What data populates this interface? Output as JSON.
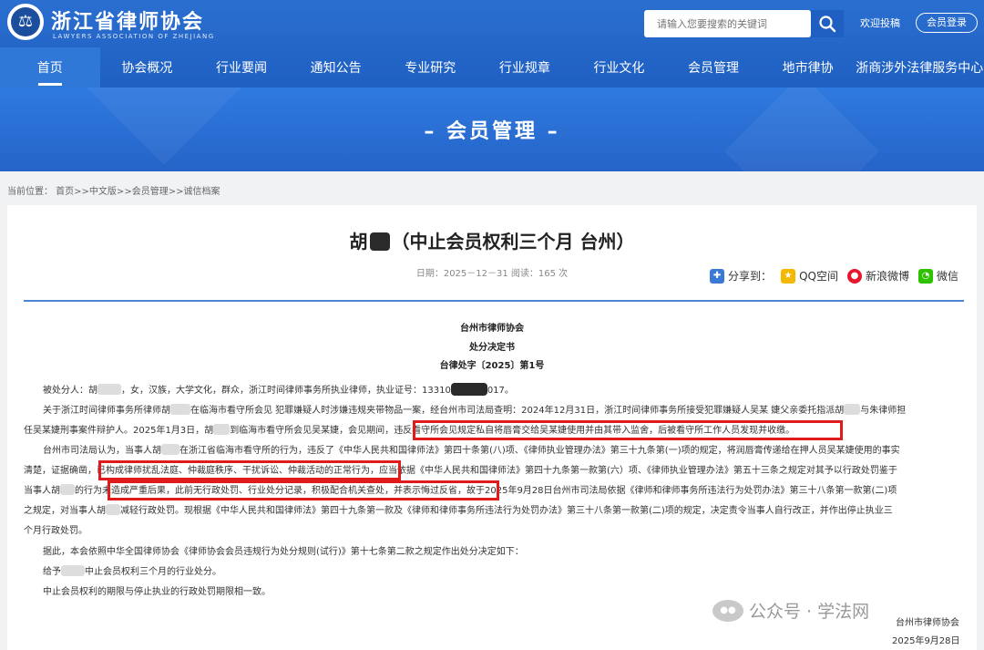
{
  "header": {
    "logo_cn": "浙江省律师协会",
    "logo_en": "LAWYERS ASSOCIATION OF ZHEJIANG",
    "search_placeholder": "请输入您要搜索的关键词",
    "post_link": "欢迎投稿",
    "login_label": "会员登录"
  },
  "nav": [
    {
      "label": "首页",
      "active": true
    },
    {
      "label": "协会概况"
    },
    {
      "label": "行业要闻"
    },
    {
      "label": "通知公告"
    },
    {
      "label": "专业研究"
    },
    {
      "label": "行业规章"
    },
    {
      "label": "行业文化"
    },
    {
      "label": "会员管理"
    },
    {
      "label": "地市律协"
    },
    {
      "label": "浙商涉外法律服务中心"
    }
  ],
  "banner": {
    "title": "– 会员管理 –"
  },
  "breadcrumb": "当前位置： 首页>>中文版>>会员管理>>诚信档案",
  "article": {
    "title_prefix": "胡",
    "title_suffix": "（中止会员权利三个月 台州）",
    "meta": "日期：2025－12－31 阅读：165 次",
    "share_label": "分享到：",
    "share_qq": "QQ空间",
    "share_weibo": "新浪微博",
    "share_wechat": "微信",
    "org": "台州市律师协会",
    "doc_type": "处分决定书",
    "doc_no": "台律处字〔2025〕第1号",
    "p1a": "被处分人：胡",
    "p1b": "，女，汉族，大学文化，群众，浙江时间律师事务所执业律师，执业证号：13310",
    "p1c": "017。",
    "p2a": "关于浙江时间律师事务所律师胡",
    "p2b": "在临海市看守所会见 犯罪嫌疑人时涉嫌违规夹带物品一案，经台州市司法局查明：2024年12月31日，浙江时间律师事务所接受犯罪嫌疑人吴某 婕父亲委托指派胡",
    "p2c": "与朱律师担",
    "p3a": "任吴某婕刑事案件辩护人。2025年1月3日，胡",
    "p3b": "到临海市看守所会见吴某婕，会见期间，",
    "p3c": "违反看守所会见规定私自将唇膏交给吴某婕使用并由其带入监舍，后被看守所工作人员发现并收缴。",
    "p4a": "台州市司法局认为，当事人胡",
    "p4b": "在浙江省临海市看守所的行为，违反了《中华人民共和国律师法》第四十条第(八)项、《律师执业管理办法》第三十九条第(一)项的规定，将润唇膏传递给在押人员吴某婕使用的事实",
    "p5a": "清楚，证据确凿，",
    "p5b": "已构成律师扰乱法庭、仲裁庭秩序、干扰诉讼、仲裁活动的正常行为，",
    "p5c": "应当依据《中华人民共和国律师法》第四十九条第一款第(六）项、《律师执业管理办法》第五十三条之规定对其予以行政处罚鉴于",
    "p6a": "当事人胡",
    "p6b": "的行为",
    "p6c": "未造成严重后果，此前无行政处罚、行业处分记录，积极配合机关查处，并表示悔过反省，",
    "p6d": "故于2025年9月28日台州市司法局依据《律师和律师事务所违法行为处罚办法》第三十八条第一款第(二)项",
    "p7a": "之规定，对当事人胡",
    "p7b": "减轻行政处罚。现根据《中华人民共和国律师法》第四十九条第一款及《律师和律师事务所违法行为处罚办法》第三十八条第一款第(二)项的规定，决定责令当事人自行改正，并作出停止执业三",
    "p8": "个月行政处罚。",
    "p9": "据此，本会依照中华全国律师协会《律师协会会员违规行为处分规则(试行)》第十七条第二款之规定作出处分决定如下：",
    "p10a": "给予",
    "p10b": "中止会员权利三个月的行业处分。",
    "p11": "中止会员权利的期限与停止执业的行政处罚期限相一致。",
    "sign_org": "台州市律师协会",
    "sign_date": "2025年9月28日"
  },
  "watermark": "公众号 · 学法网",
  "colors": {
    "brand_blue": "#1f5fc2",
    "highlight_red": "#e01b1b"
  }
}
